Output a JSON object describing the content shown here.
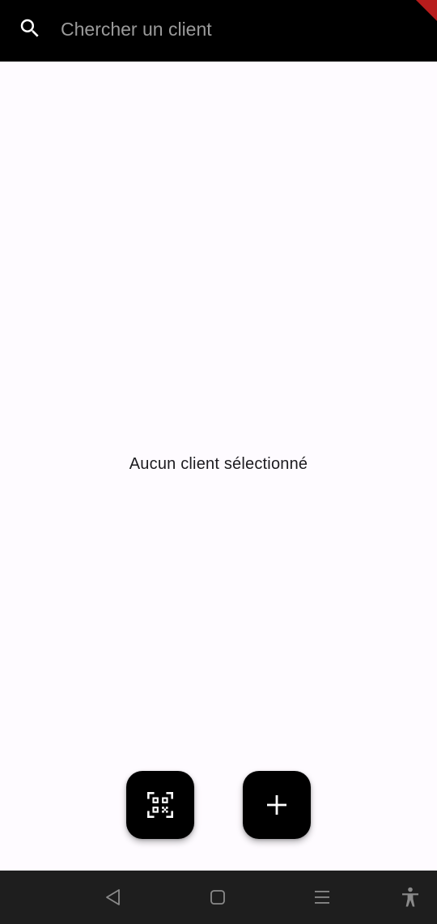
{
  "search": {
    "placeholder": "Chercher un client",
    "value": "",
    "icon": "search-icon"
  },
  "main": {
    "empty_state_text": "Aucun client sélectionné"
  },
  "fabs": {
    "scan_icon": "qr-code-scanner-icon",
    "add_icon": "plus-icon"
  },
  "system_nav": {
    "buttons": [
      "back-icon",
      "home-icon",
      "recents-icon",
      "accessibility-icon"
    ]
  },
  "colors": {
    "appbar": "#000000",
    "background": "#fefbff",
    "fab": "#000000",
    "navbar": "#1e1e1e",
    "debug_banner": "#b71c1c",
    "placeholder": "#9a9a9a"
  }
}
